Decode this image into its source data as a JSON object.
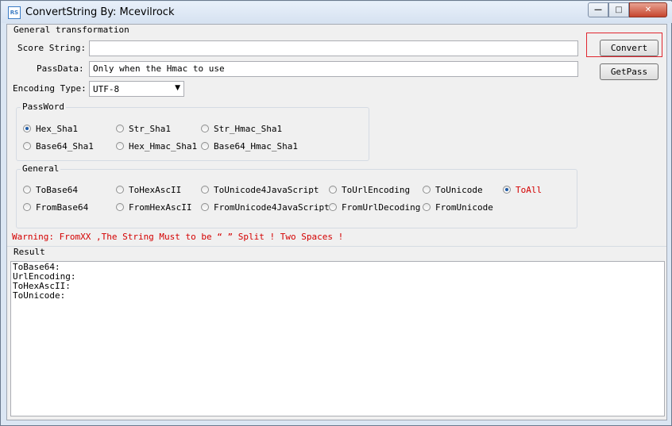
{
  "window": {
    "title": "ConvertString By: Mcevilrock",
    "icon_text": "RS"
  },
  "general_transformation": {
    "label": "General transformation",
    "score_string_label": "Score String:",
    "score_string_value": "",
    "passdata_label": "PassData:",
    "passdata_value": "Only when the Hmac to use",
    "encoding_label": "Encoding Type:",
    "encoding_value": "UTF-8"
  },
  "buttons": {
    "convert": "Convert",
    "getpass": "GetPass"
  },
  "password_group": {
    "label": "PassWord",
    "options": [
      "Hex_Sha1",
      "Str_Sha1",
      "Str_Hmac_Sha1",
      "Base64_Sha1",
      "Hex_Hmac_Sha1",
      "Base64_Hmac_Sha1"
    ],
    "selected": "Hex_Sha1"
  },
  "general_group": {
    "label": "General",
    "options": [
      "ToBase64",
      "ToHexAscII",
      "ToUnicode4JavaScript",
      "ToUrlEncoding",
      "ToUnicode",
      "ToAll",
      "FromBase64",
      "FromHexAscII",
      "FromUnicode4JavaScript",
      "FromUrlDecoding",
      "FromUnicode"
    ],
    "selected": "ToAll"
  },
  "warning": "Warning:  FromXX ,The String Must to be “  ” Split ! Two Spaces !",
  "result": {
    "label": "Result",
    "lines": [
      "ToBase64:",
      "UrlEncoding:",
      "ToHexAscII:",
      "ToUnicode:"
    ]
  },
  "colors": {
    "accent_red": "#d40000",
    "highlight": "#e0262f",
    "radio_selected": "#1d5aa6"
  }
}
